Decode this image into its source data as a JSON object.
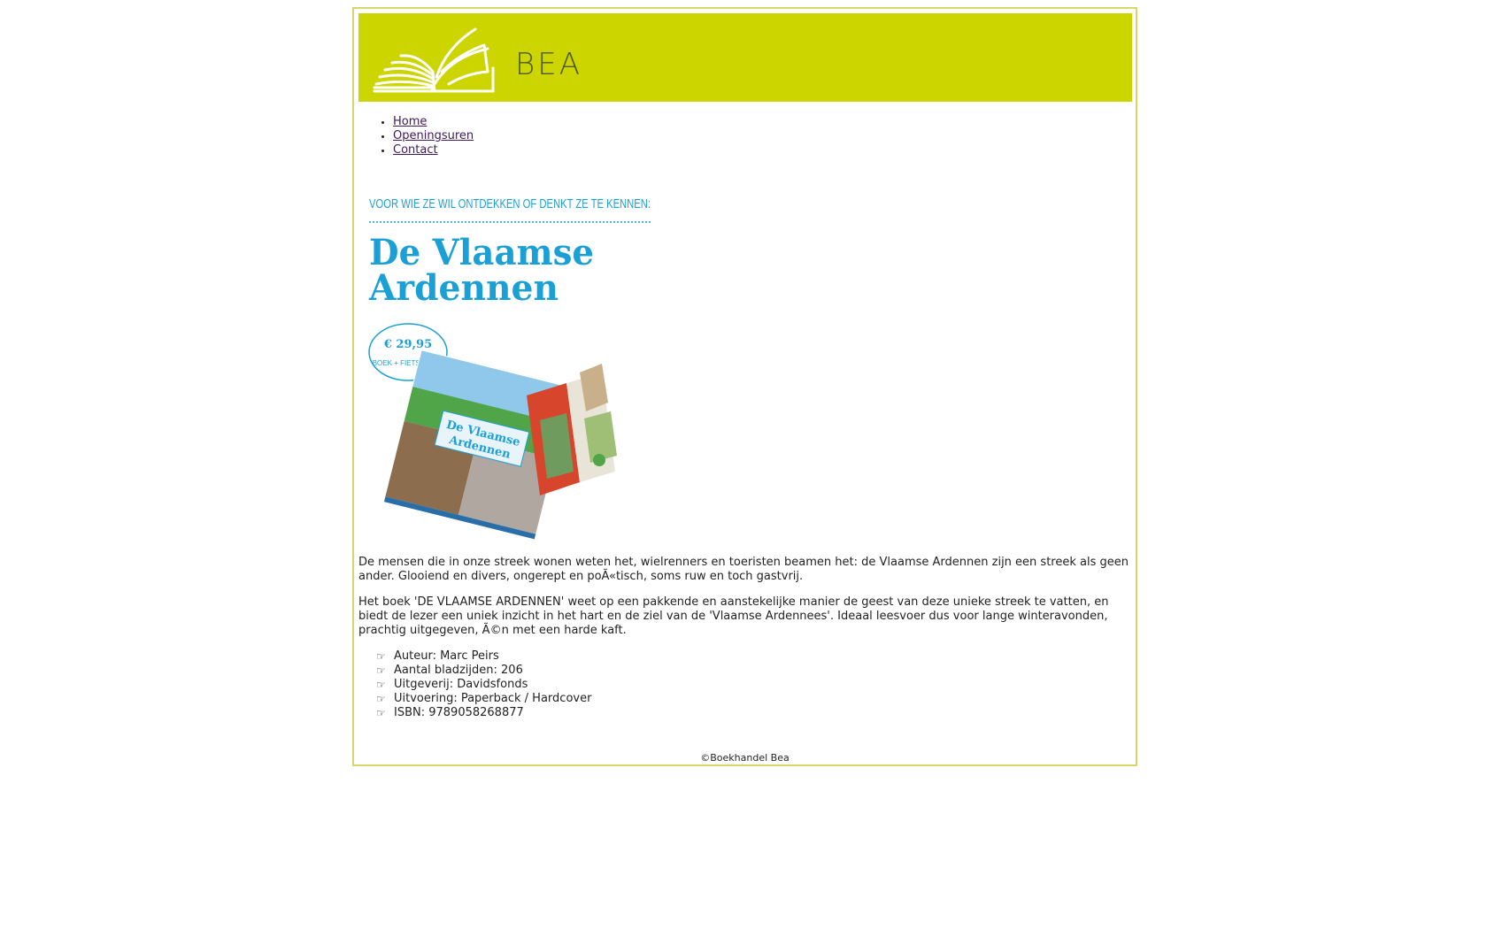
{
  "brand": {
    "name": "BEA"
  },
  "nav": {
    "items": [
      {
        "label": "Home"
      },
      {
        "label": "Openingsuren"
      },
      {
        "label": "Contact"
      }
    ]
  },
  "promo": {
    "tagline": "VOOR WIE ZE WIL ONTDEKKEN OF DENKT ZE TE KENNEN:",
    "title_line1": "De Vlaamse",
    "title_line2": "Ardennen",
    "price": "€ 29,95",
    "price_note": "BOEK + FIETSKAART",
    "cover_title_line1": "De Vlaamse",
    "cover_title_line2": "Ardennen",
    "colors": {
      "accent": "#1ba0d6",
      "map_red": "#d8452d"
    }
  },
  "content": {
    "paragraph1": "De mensen die in onze streek wonen weten het, wielrenners en toeristen beamen het: de Vlaamse Ardennen zijn een streek als geen ander. Glooiend en divers, ongerept en poÃ«tisch, soms ruw en toch gastvrij.",
    "paragraph2": "Het boek 'DE VLAAMSE ARDENNEN' weet op een pakkende en aanstekelijke manier de geest van deze unieke streek te vatten, en biedt de lezer een uniek inzicht in het hart en de ziel van de 'Vlaamse Ardennees'. Ideaal leesvoer dus voor lange winteravonden, prachtig uitgegeven, Ã©n met een harde kaft.",
    "specs": [
      {
        "icon": "pointing-hand-icon",
        "label": "Auteur: Marc Peirs"
      },
      {
        "icon": "pointing-hand-icon",
        "label": "Aantal bladzijden: 206"
      },
      {
        "icon": "pointing-hand-icon",
        "label": "Uitgeverij: Davidsfonds"
      },
      {
        "icon": "pointing-hand-icon",
        "label": "Uitvoering: Paperback / Hardcover"
      },
      {
        "icon": "pointing-hand-icon",
        "label": "ISBN: 9789058268877"
      }
    ]
  },
  "footer": {
    "text": "©Boekhandel Bea"
  },
  "colors": {
    "header_bg": "#cdd500",
    "border": "#d8d66a",
    "link": "#3d1a5c"
  }
}
